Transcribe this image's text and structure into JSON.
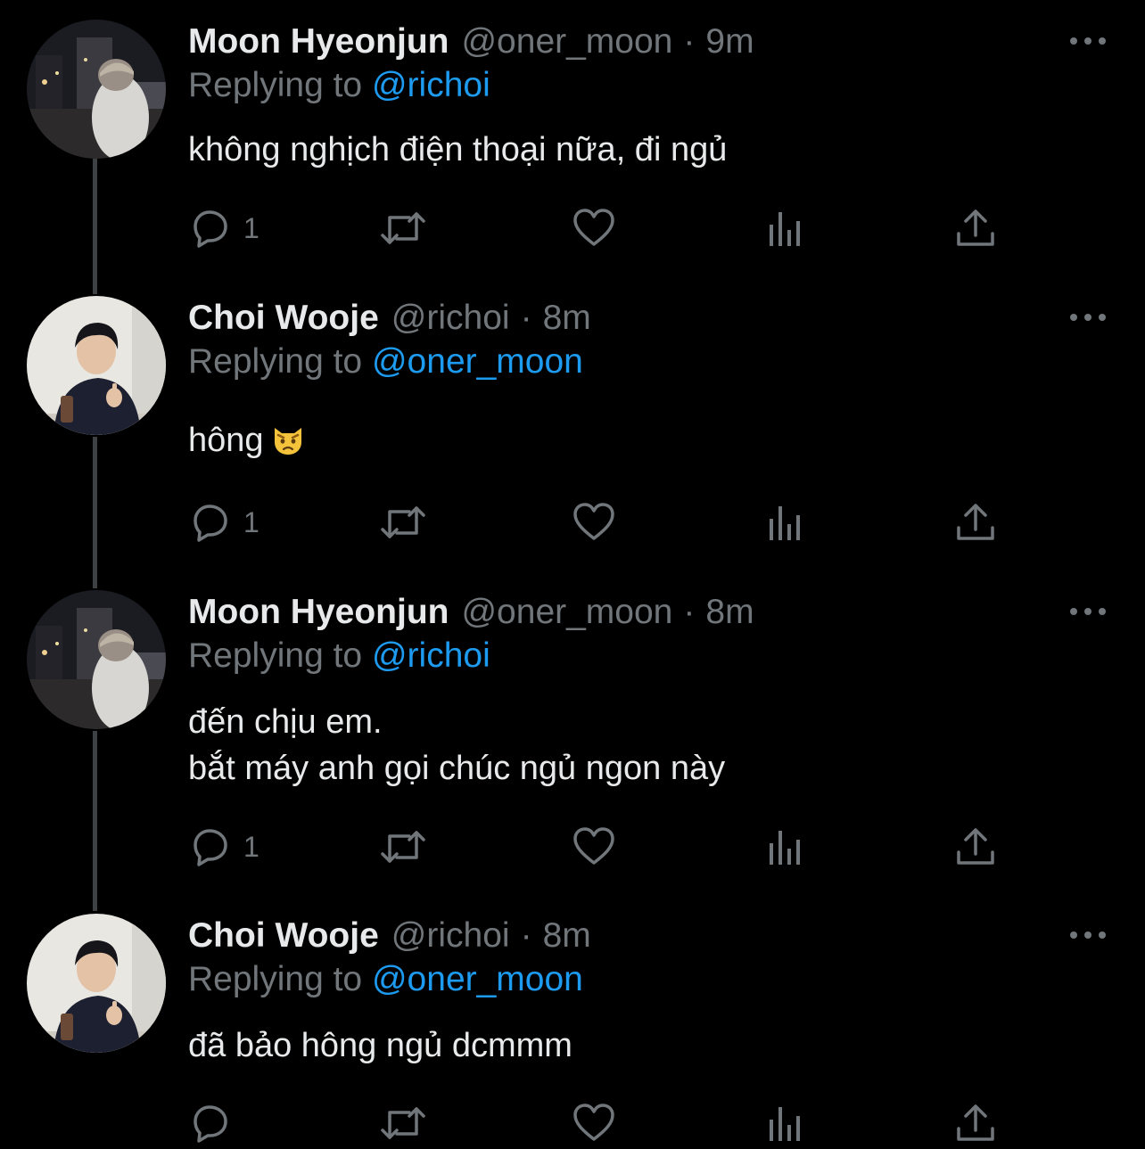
{
  "tweets": [
    {
      "name": "Moon Hyeonjun",
      "handle": "@oner_moon",
      "separator": "·",
      "time": "9m",
      "replying_prefix": "Replying to",
      "replying_to": "@richoi",
      "lines": [
        "không nghịch điện thoại nữa, đi ngủ"
      ],
      "reply_count": "1",
      "avatar_icon": "night-street-photo"
    },
    {
      "name": "Choi Wooje",
      "handle": "@richoi",
      "separator": "·",
      "time": "8m",
      "replying_prefix": "Replying to",
      "replying_to": "@oner_moon",
      "lines": [
        "hông"
      ],
      "emoji_icon": "pouting-cat-face-icon",
      "reply_count": "1",
      "avatar_icon": "person-thumbs-up-photo"
    },
    {
      "name": "Moon Hyeonjun",
      "handle": "@oner_moon",
      "separator": "·",
      "time": "8m",
      "replying_prefix": "Replying to",
      "replying_to": "@richoi",
      "lines": [
        "đến chịu em.",
        "bắt máy anh gọi chúc ngủ ngon này"
      ],
      "reply_count": "1",
      "avatar_icon": "night-street-photo"
    },
    {
      "name": "Choi Wooje",
      "handle": "@richoi",
      "separator": "·",
      "time": "8m",
      "replying_prefix": "Replying to",
      "replying_to": "@oner_moon",
      "lines": [
        "đã bảo hông ngủ dcmmm"
      ],
      "reply_count": "",
      "avatar_icon": "person-thumbs-up-photo"
    }
  ],
  "icons": {
    "reply": "speech-bubble-icon",
    "retweet": "retweet-arrows-icon",
    "like": "heart-icon",
    "views": "bar-chart-icon",
    "share": "share-upload-icon",
    "more": "more-dots-icon"
  },
  "colors": {
    "background": "#000000",
    "primary_text": "#e7e9ea",
    "secondary_text": "#71767b",
    "mention": "#1d9bf0",
    "thread_line": "#3e4144"
  }
}
